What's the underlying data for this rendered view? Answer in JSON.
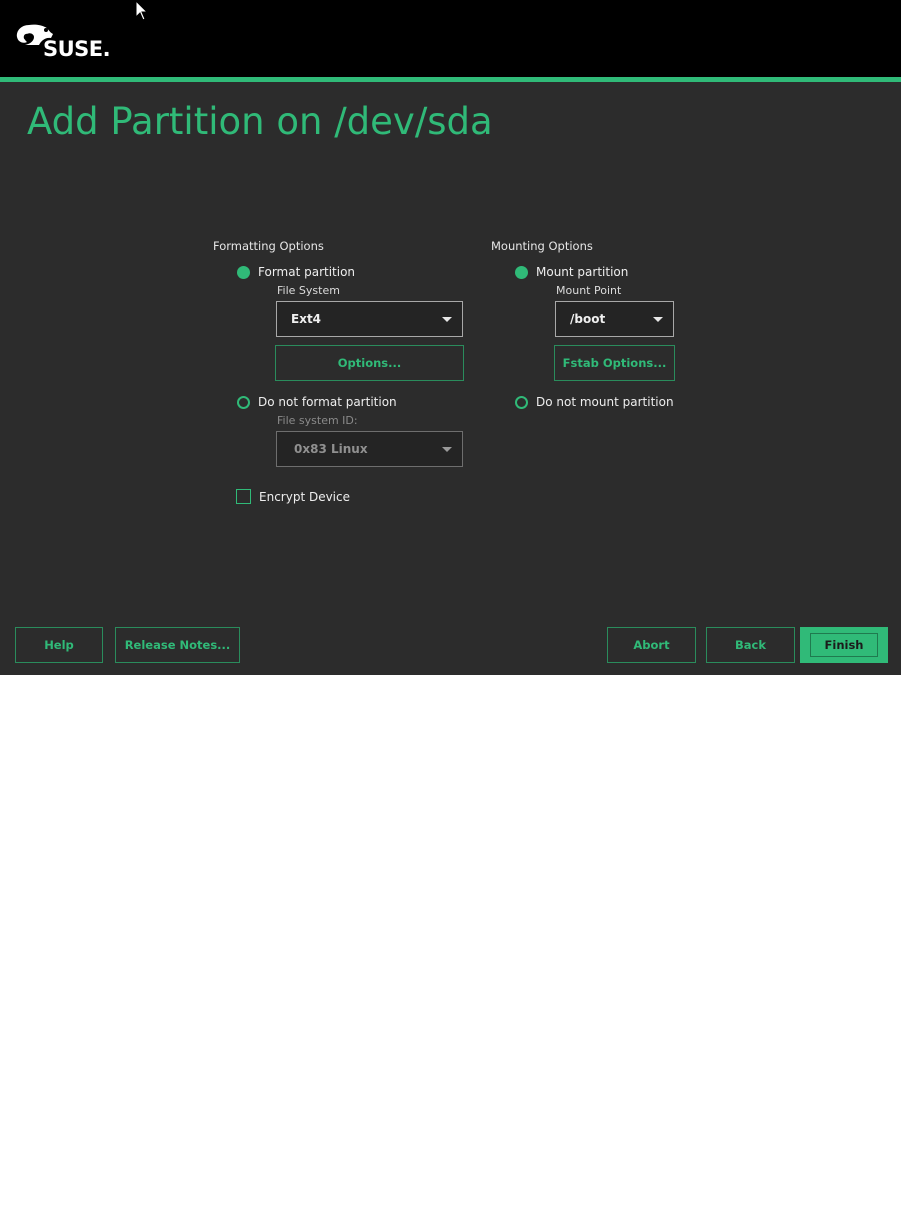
{
  "header": {
    "logo_text": "SUSE.",
    "logo_icon": "chameleon-icon",
    "accent_color": "#30ba78"
  },
  "page_title": "Add Partition on /dev/sda",
  "formatting": {
    "section_title": "Formatting Options",
    "format_label": "Format partition",
    "format_selected": true,
    "file_system_label": "File System",
    "file_system_value": "Ext4",
    "options_button": "Options...",
    "no_format_label": "Do not format partition",
    "no_format_selected": false,
    "fs_id_label": "File system ID:",
    "fs_id_value": "0x83 Linux",
    "encrypt_label": "Encrypt Device",
    "encrypt_checked": false
  },
  "mounting": {
    "section_title": "Mounting Options",
    "mount_label": "Mount partition",
    "mount_selected": true,
    "mount_point_label": "Mount Point",
    "mount_point_value": "/boot",
    "fstab_button": "Fstab Options...",
    "no_mount_label": "Do not mount partition",
    "no_mount_selected": false
  },
  "footer": {
    "help": "Help",
    "release_notes": "Release Notes...",
    "abort": "Abort",
    "back": "Back",
    "finish": "Finish"
  }
}
